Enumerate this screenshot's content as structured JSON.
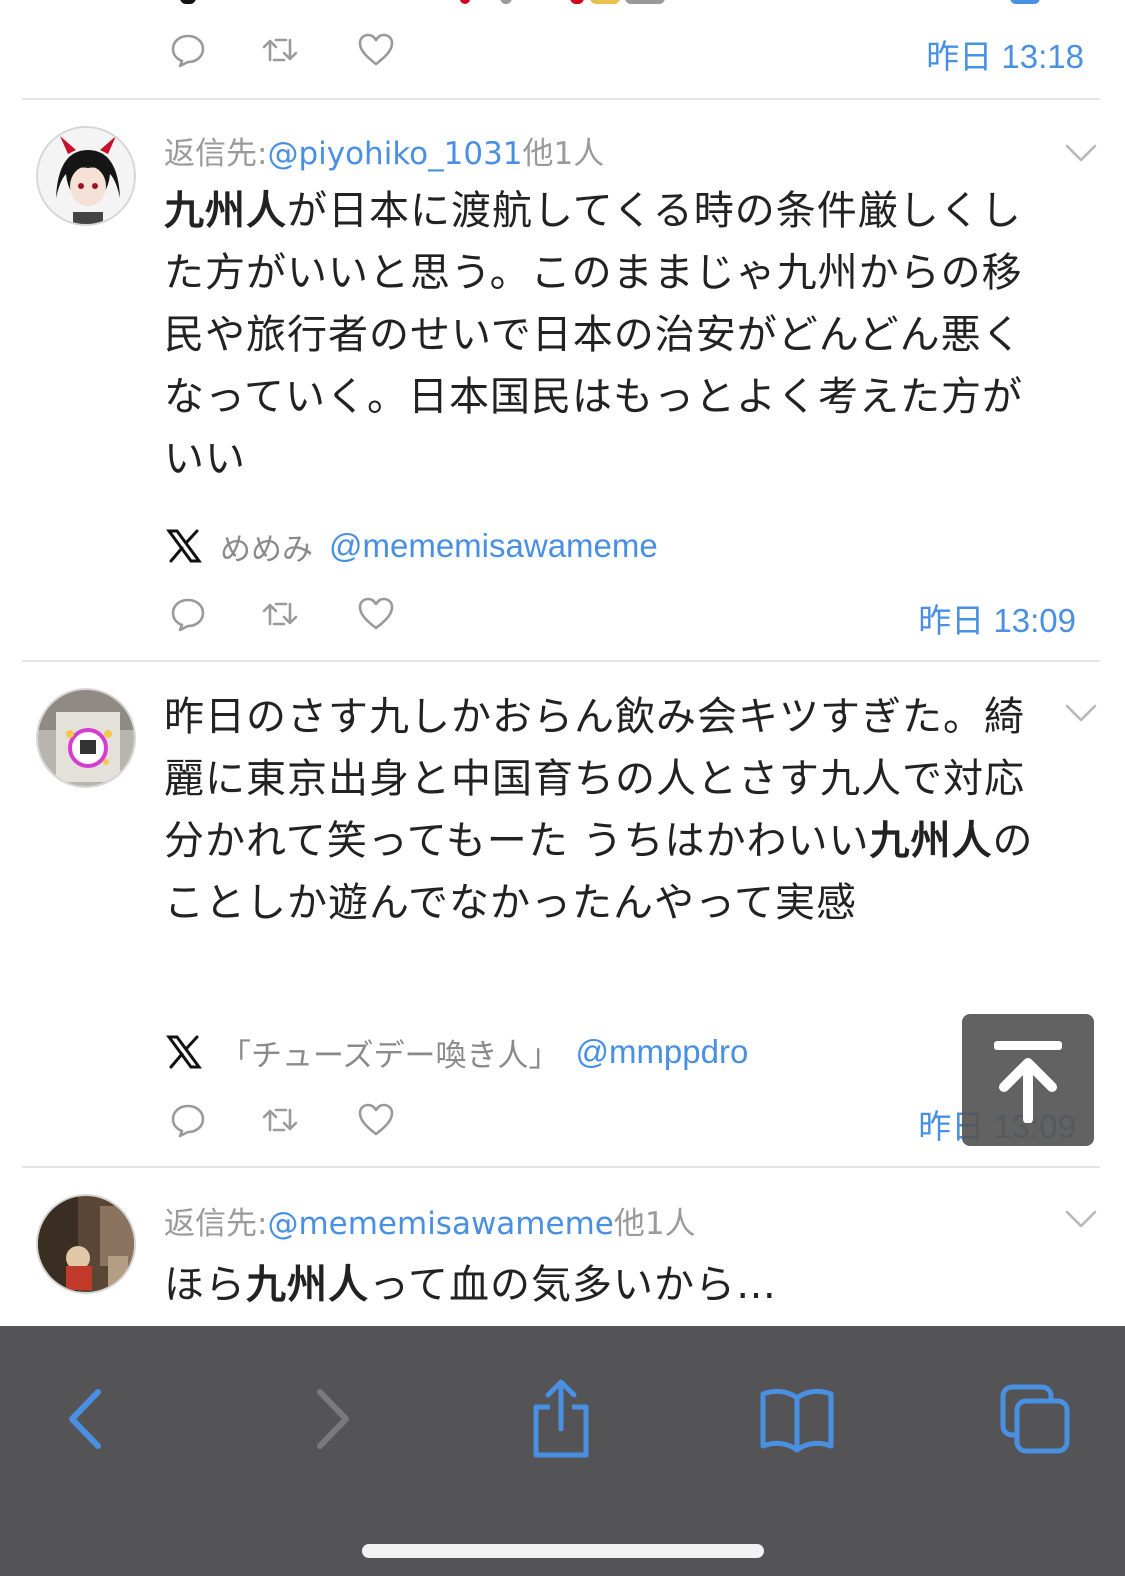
{
  "feed": {
    "previous_tweet": {
      "timestamp": "昨日 13:18"
    },
    "tweets": [
      {
        "reply_prefix": "返信先:",
        "reply_handle": "@piyohiko_1031",
        "reply_suffix": "他1人",
        "text_bold": "九州人",
        "text_rest": "が日本に渡航してくる時の条件厳しくした方がいいと思う。このままじゃ九州からの移民や旅行者のせいで日本の治安がどんどん悪くなっていく。日本国民はもっとよく考えた方がいい",
        "source_name": "めめみ",
        "source_user": "@mememisawameme",
        "timestamp": "昨日 13:09"
      },
      {
        "text_before": "昨日のさす九しかおらん飲み会キツすぎた。綺麗に東京出身と中国育ちの人とさす九人で対応分かれて笑ってもーた うちはかわいい",
        "text_bold": "九州人",
        "text_after": "のことしか遊んでなかったんやって実感",
        "source_name": "「チューズデー喚き人」",
        "source_user": "@mmppdro",
        "timestamp": "昨日 13:09"
      },
      {
        "reply_prefix": "返信先:",
        "reply_handle": "@mememisawameme",
        "reply_suffix": "他1人",
        "text_before": "ほら",
        "text_bold": "九州人",
        "text_after": "って血の気多いから…"
      }
    ]
  },
  "icons": {
    "reply": "reply-bubble-icon",
    "retweet": "retweet-icon",
    "like": "heart-icon",
    "more": "chevron-down-icon",
    "x_logo": "x-logo-icon",
    "scroll_top": "arrow-up-to-top-icon"
  },
  "toolbar": {
    "back": "chevron-left-icon",
    "forward": "chevron-right-icon",
    "share": "share-icon",
    "bookmarks": "book-icon",
    "tabs": "tabs-icon"
  },
  "colors": {
    "link_blue": "#4a90e2",
    "toolbar_bg": "#545456",
    "toolbar_icon_active": "#4a90e2",
    "toolbar_icon_disabled": "#7a7a7c"
  }
}
